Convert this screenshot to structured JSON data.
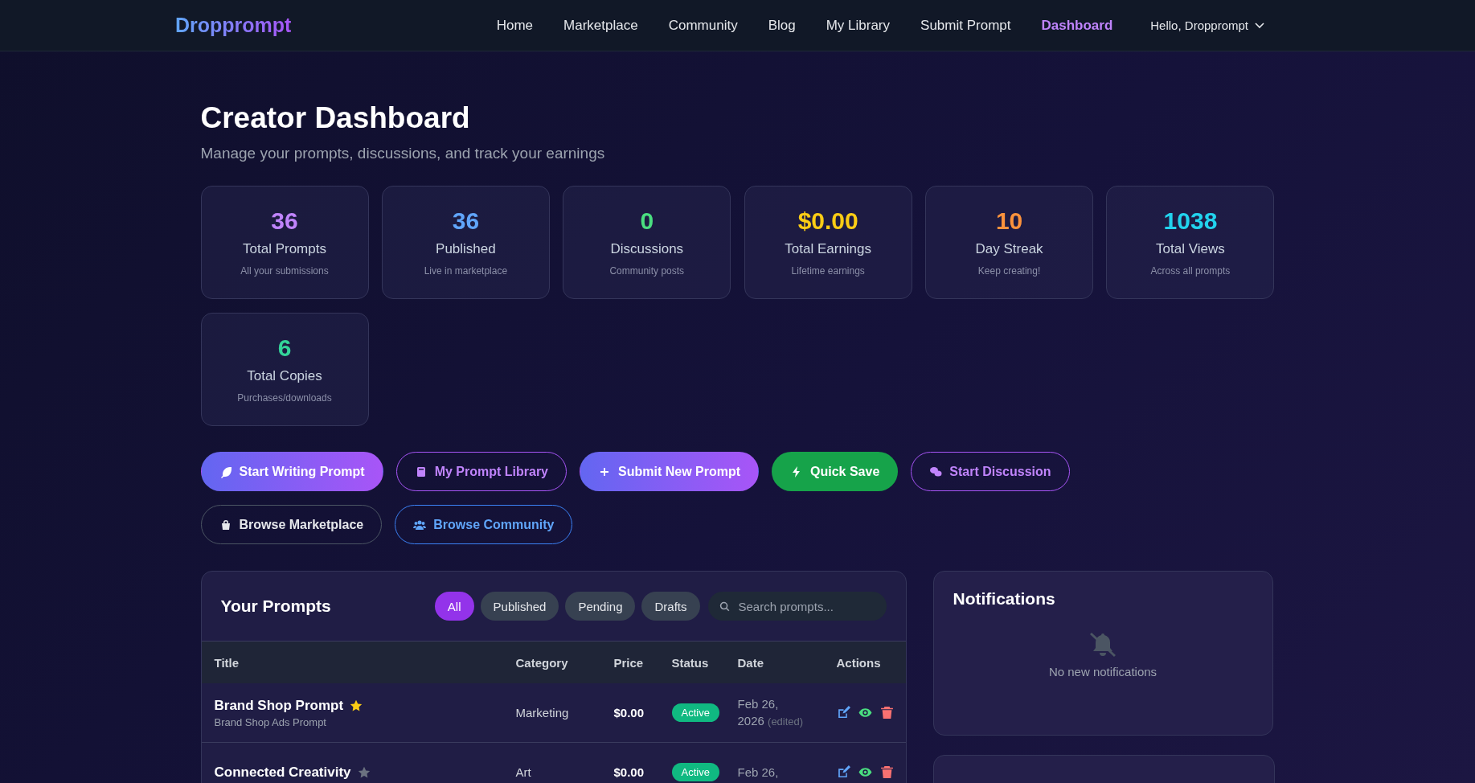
{
  "brand": "Dropprompt",
  "nav": [
    {
      "label": "Home",
      "selected": false
    },
    {
      "label": "Marketplace",
      "selected": false
    },
    {
      "label": "Community",
      "selected": false
    },
    {
      "label": "Blog",
      "selected": false
    },
    {
      "label": "My Library",
      "selected": false
    },
    {
      "label": "Submit Prompt",
      "selected": false
    },
    {
      "label": "Dashboard",
      "selected": true
    }
  ],
  "user_menu": "Hello, Dropprompt",
  "header": {
    "title": "Creator Dashboard",
    "subtitle": "Manage your prompts, discussions, and track your earnings"
  },
  "stats": [
    {
      "value": "36",
      "label": "Total Prompts",
      "caption": "All your submissions",
      "color": "#c084fc"
    },
    {
      "value": "36",
      "label": "Published",
      "caption": "Live in marketplace",
      "color": "#60a5fa"
    },
    {
      "value": "0",
      "label": "Discussions",
      "caption": "Community posts",
      "color": "#4ade80"
    },
    {
      "value": "$0.00",
      "label": "Total Earnings",
      "caption": "Lifetime earnings",
      "color": "#facc15"
    },
    {
      "value": "10",
      "label": "Day Streak",
      "caption": "Keep creating!",
      "color": "#fb923c"
    },
    {
      "value": "1038",
      "label": "Total Views",
      "caption": "Across all prompts",
      "color": "#22d3ee"
    },
    {
      "value": "6",
      "label": "Total Copies",
      "caption": "Purchases/downloads",
      "color": "#34d399"
    }
  ],
  "actions": [
    {
      "label": "Start Writing Prompt",
      "kind": "primary"
    },
    {
      "label": "My Prompt Library",
      "kind": "outline"
    },
    {
      "label": "Submit New Prompt",
      "kind": "primary"
    },
    {
      "label": "Quick Save",
      "kind": "success"
    },
    {
      "label": "Start Discussion",
      "kind": "outline"
    },
    {
      "label": "Browse Marketplace",
      "kind": "ghost"
    },
    {
      "label": "Browse Community",
      "kind": "info"
    }
  ],
  "prompts": {
    "title": "Your Prompts",
    "filters": [
      {
        "label": "All",
        "selected": true
      },
      {
        "label": "Published",
        "selected": false
      },
      {
        "label": "Pending",
        "selected": false
      },
      {
        "label": "Drafts",
        "selected": false
      }
    ],
    "search": {
      "placeholder": "Search prompts..."
    },
    "columns": [
      "Title",
      "Category",
      "Price",
      "Status",
      "Date",
      "Actions"
    ],
    "rows": [
      {
        "title": "Brand Shop Prompt",
        "subtitle": "Brand Shop Ads Prompt",
        "featured": true,
        "category": "Marketing",
        "price": "$0.00",
        "status": "Active",
        "date": "Feb 26,",
        "year": "2026",
        "note": "(edited)"
      },
      {
        "title": "Connected Creativity",
        "featured": false,
        "category": "Art",
        "price": "$0.00",
        "status": "Active",
        "date": "Feb 26,"
      }
    ]
  },
  "notifications": {
    "title": "Notifications",
    "empty": "No new notifications"
  }
}
